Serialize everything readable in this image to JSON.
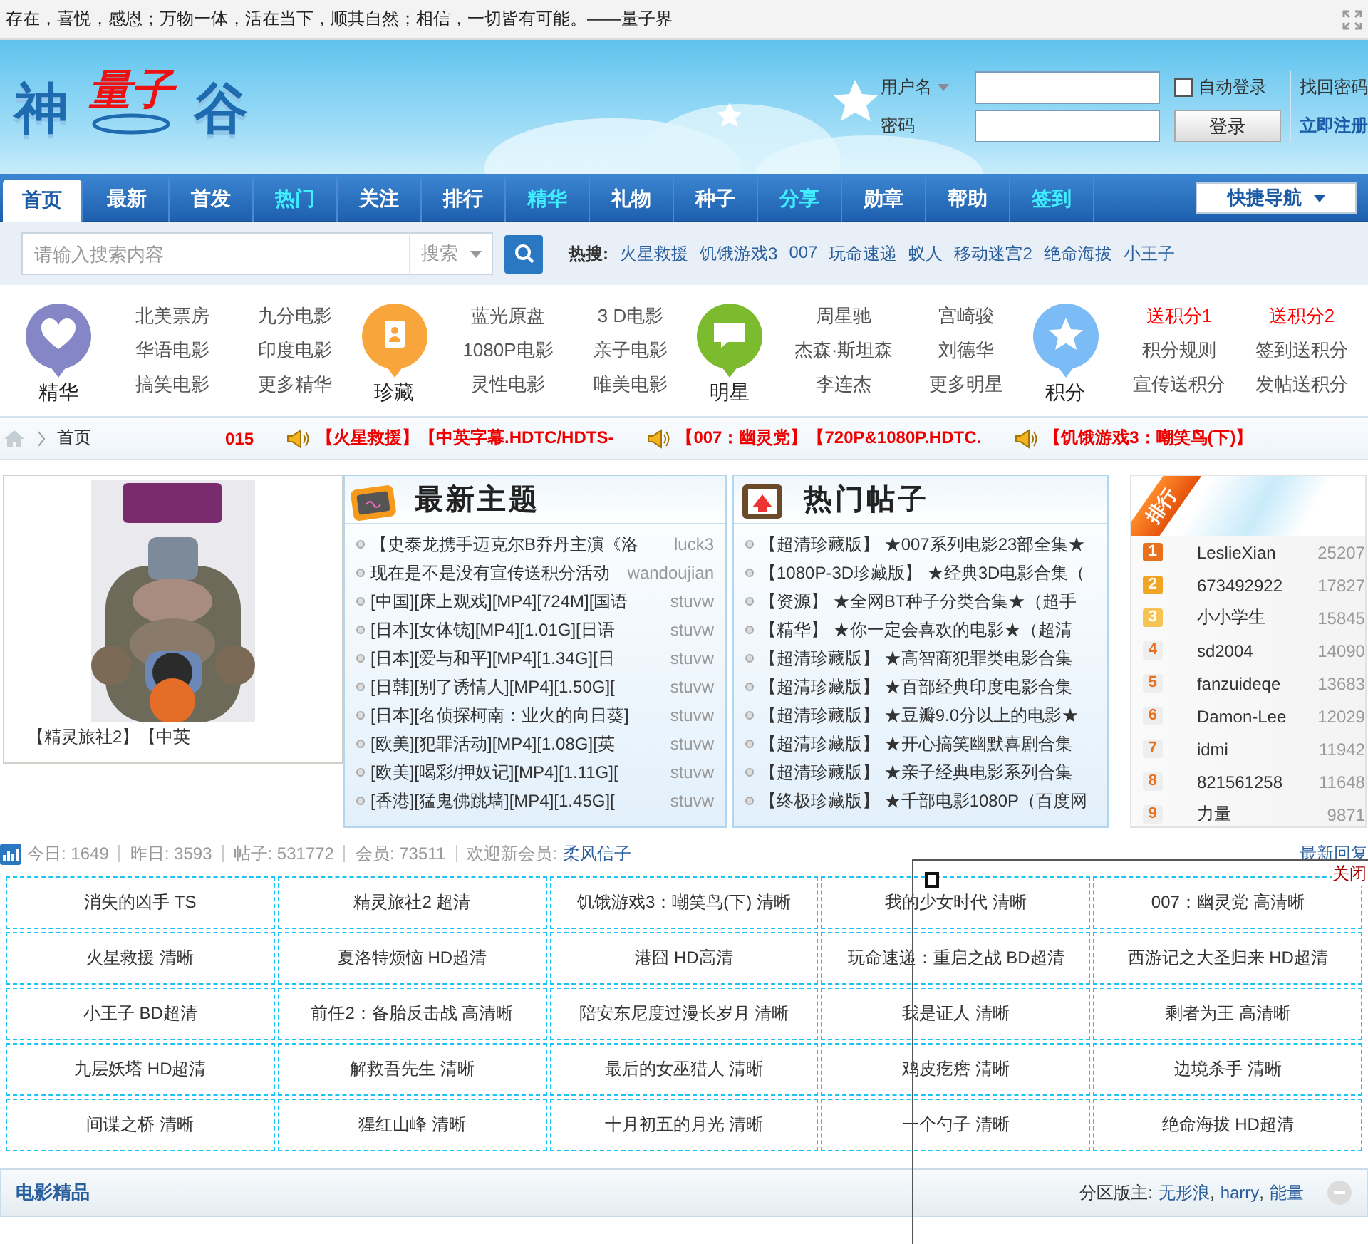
{
  "top_bar": {
    "motto": "存在，喜悦，感恩；万物一体，活在当下，顺其自然；相信，一切皆有可能。——量子界"
  },
  "logo": {
    "chars": [
      "神",
      "量子",
      "谷"
    ]
  },
  "login": {
    "username_label": "用户名",
    "password_label": "密码",
    "auto_login": {
      "label": "自动登录",
      "checked": false
    },
    "login_button": "登录",
    "links": [
      "找回密码",
      "立即注册"
    ]
  },
  "nav": {
    "tabs": [
      {
        "label": "首页",
        "selected": true,
        "highlight": false
      },
      {
        "label": "最新",
        "selected": false,
        "highlight": false
      },
      {
        "label": "首发",
        "selected": false,
        "highlight": false
      },
      {
        "label": "热门",
        "selected": false,
        "highlight": true
      },
      {
        "label": "关注",
        "selected": false,
        "highlight": false
      },
      {
        "label": "排行",
        "selected": false,
        "highlight": false
      },
      {
        "label": "精华",
        "selected": false,
        "highlight": true
      },
      {
        "label": "礼物",
        "selected": false,
        "highlight": false
      },
      {
        "label": "种子",
        "selected": false,
        "highlight": false
      },
      {
        "label": "分享",
        "selected": false,
        "highlight": true
      },
      {
        "label": "勋章",
        "selected": false,
        "highlight": false
      },
      {
        "label": "帮助",
        "selected": false,
        "highlight": false
      },
      {
        "label": "签到",
        "selected": false,
        "highlight": true
      }
    ],
    "quick_nav": "快捷导航"
  },
  "search": {
    "placeholder": "请输入搜索内容",
    "scope": "搜索",
    "hot_label": "热搜:",
    "hot_terms": [
      "火星救援",
      "饥饿游戏3",
      "007",
      "玩命速递",
      "蚁人",
      "移动迷宫2",
      "绝命海拔",
      "小王子"
    ]
  },
  "categories": [
    {
      "title": "精华",
      "kind": "heart",
      "color": "#8586c6",
      "links": [
        {
          "text": "北美票房",
          "highlight": false
        },
        {
          "text": "九分电影",
          "highlight": false
        },
        {
          "text": "华语电影",
          "highlight": false
        },
        {
          "text": "印度电影",
          "highlight": false
        },
        {
          "text": "搞笑电影",
          "highlight": false
        },
        {
          "text": "更多精华",
          "highlight": false
        }
      ]
    },
    {
      "title": "珍藏",
      "kind": "book",
      "color": "#f8a53c",
      "links": [
        {
          "text": "蓝光原盘",
          "highlight": false
        },
        {
          "text": "3 D电影",
          "highlight": false
        },
        {
          "text": "1080P电影",
          "highlight": false
        },
        {
          "text": "亲子电影",
          "highlight": false
        },
        {
          "text": "灵性电影",
          "highlight": false
        },
        {
          "text": "唯美电影",
          "highlight": false
        }
      ]
    },
    {
      "title": "明星",
      "kind": "chat",
      "color": "#7cba2e",
      "links": [
        {
          "text": "周星驰",
          "highlight": false
        },
        {
          "text": "宫崎骏",
          "highlight": false
        },
        {
          "text": "杰森·斯坦森",
          "highlight": false
        },
        {
          "text": "刘德华",
          "highlight": false
        },
        {
          "text": "李连杰",
          "highlight": false
        },
        {
          "text": "更多明星",
          "highlight": false
        }
      ]
    },
    {
      "title": "积分",
      "kind": "star",
      "color": "#7cbcf6",
      "links": [
        {
          "text": "送积分1",
          "highlight": true
        },
        {
          "text": "送积分2",
          "highlight": true
        },
        {
          "text": "积分规则",
          "highlight": false
        },
        {
          "text": "签到送积分",
          "highlight": false
        },
        {
          "text": "宣传送积分",
          "highlight": false
        },
        {
          "text": "发帖送积分",
          "highlight": false
        }
      ]
    }
  ],
  "breadcrumb": {
    "home": "首页"
  },
  "ticker": [
    {
      "text": "015",
      "icon": false
    },
    {
      "text": "【火星救援】【中英字幕.HDTC/HDTS-",
      "icon": true
    },
    {
      "text": "【007：幽灵党】【720P&1080P.HDTC.",
      "icon": true
    },
    {
      "text": "【饥饿游戏3：嘲笑鸟(下)】",
      "icon": true
    }
  ],
  "featured": {
    "caption": "【精灵旅社2】【中英"
  },
  "latest": {
    "title": "最新主题",
    "rows": [
      {
        "title": "【史泰龙携手迈克尔B乔丹主演《洛",
        "author": "luck3"
      },
      {
        "title": "现在是不是没有宣传送积分活动",
        "author": "wandoujian"
      },
      {
        "title": "[中国][床上观戏][MP4][724M][国语",
        "author": "stuvw"
      },
      {
        "title": "[日本][女体铳][MP4][1.01G][日语",
        "author": "stuvw"
      },
      {
        "title": "[日本][爱与和平][MP4][1.34G][日",
        "author": "stuvw"
      },
      {
        "title": "[日韩][别了诱情人][MP4][1.50G][",
        "author": "stuvw"
      },
      {
        "title": "[日本][名侦探柯南：业火的向日葵]",
        "author": "stuvw"
      },
      {
        "title": "[欧美][犯罪活动][MP4][1.08G][英",
        "author": "stuvw"
      },
      {
        "title": "[欧美][喝彩/押奴记][MP4][1.11G][",
        "author": "stuvw"
      },
      {
        "title": "[香港][猛鬼佛跳墙][MP4][1.45G][",
        "author": "stuvw"
      }
    ]
  },
  "hot": {
    "title": "热门帖子",
    "rows": [
      "【超清珍藏版】 ★007系列电影23部全集★",
      "【1080P-3D珍藏版】 ★经典3D电影合集（",
      "【资源】 ★全网BT种子分类合集★（超手",
      "【精华】 ★你一定会喜欢的电影★（超清",
      "【超清珍藏版】 ★高智商犯罪类电影合集",
      "【超清珍藏版】 ★百部经典印度电影合集",
      "【超清珍藏版】 ★豆瓣9.0分以上的电影★",
      "【超清珍藏版】 ★开心搞笑幽默喜剧合集",
      "【超清珍藏版】 ★亲子经典电影系列合集",
      "【终极珍藏版】 ★千部电影1080P（百度网"
    ]
  },
  "ranking": {
    "title": "排行",
    "rows": [
      {
        "rank": "1",
        "name": "LeslieXian",
        "score": "25207",
        "color": "#e8701e"
      },
      {
        "rank": "2",
        "name": "673492922",
        "score": "17827",
        "color": "#f0a526"
      },
      {
        "rank": "3",
        "name": "小小学生",
        "score": "15845",
        "color": "#f6c455"
      },
      {
        "rank": "4",
        "name": "sd2004",
        "score": "14090",
        "color": "#eeeeee"
      },
      {
        "rank": "5",
        "name": "fanzuideqe",
        "score": "13683",
        "color": "#eeeeee"
      },
      {
        "rank": "6",
        "name": "Damon-Lee",
        "score": "12029",
        "color": "#eeeeee"
      },
      {
        "rank": "7",
        "name": "idmi",
        "score": "11942",
        "color": "#eeeeee"
      },
      {
        "rank": "8",
        "name": "821561258",
        "score": "11648",
        "color": "#eeeeee"
      },
      {
        "rank": "9",
        "name": "力量",
        "score": "9871",
        "color": "#eeeeee"
      }
    ]
  },
  "stats": {
    "items": [
      "今日: 1649",
      "昨日: 3593",
      "帖子: 531772",
      "会员: 73511"
    ],
    "welcome_label": "欢迎新会员:",
    "new_member": "柔风信子",
    "latest_reply": "最新回复"
  },
  "movie_grid": [
    [
      "消失的凶手 TS",
      "精灵旅社2 超清",
      "饥饿游戏3：嘲笑鸟(下) 清晰",
      "我的少女时代 清晰",
      "007：幽灵党 高清晰"
    ],
    [
      "火星救援 清晰",
      "夏洛特烦恼 HD超清",
      "港囧 HD高清",
      "玩命速递：重启之战 BD超清",
      "西游记之大圣归来 HD超清"
    ],
    [
      "小王子 BD超清",
      "前任2：备胎反击战 高清晰",
      "陪安东尼度过漫长岁月 清晰",
      "我是证人 清晰",
      "剩者为王 高清晰"
    ],
    [
      "九层妖塔 HD超清",
      "解救吾先生 清晰",
      "最后的女巫猎人 清晰",
      "鸡皮疙瘩 清晰",
      "边境杀手 清晰"
    ],
    [
      "间谍之桥 清晰",
      "猩红山峰 清晰",
      "十月初五的月光 清晰",
      "一个勺子 清晰",
      "绝命海拔 HD超清"
    ]
  ],
  "section": {
    "title": "电影精品",
    "moderators_label": "分区版主:",
    "moderators": [
      "无形浪",
      "harry",
      "能量"
    ],
    "separator": ","
  },
  "popup": {
    "close": "关闭"
  }
}
